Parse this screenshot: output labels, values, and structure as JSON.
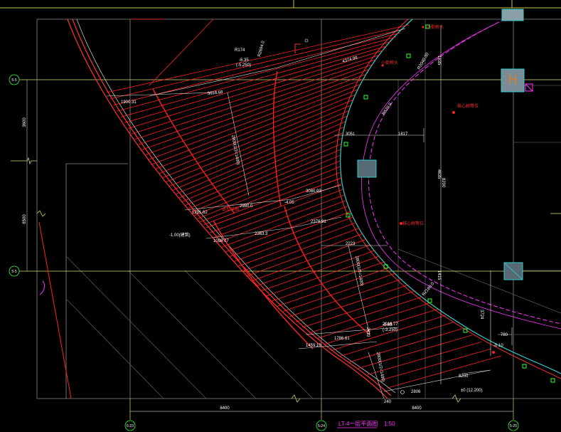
{
  "colors": {
    "background": "#000000",
    "dimension": "#ffffff",
    "stair_red": "#ff2020",
    "magenta": "#ff33ff",
    "cyan": "#33cccc",
    "green": "#00ff00",
    "yellow": "#ffff00",
    "grey": "#808080"
  },
  "axes": {
    "left_top": "5-5",
    "left_mid": "5-5",
    "bottom_left": "5-23",
    "bottom_mid": "5-24",
    "bottom_right": "5-25"
  },
  "radii": {
    "r1": "R2694.0",
    "r2": "R2040.00",
    "r3": "R670.0",
    "r4": "R2160.0"
  },
  "dimensions": {
    "d_1900": "1900.31",
    "d_5618": "5618.68",
    "d_4374": "4374.98",
    "d_2800_23": "2800(1/2=1400)",
    "d_1291": "1291.62",
    "d_2980_a": "2980.0",
    "d_3080": "3080.93",
    "d_1098": "1098.77",
    "d_2363": "2363.3",
    "d_2378": "2378.91",
    "d_3051": "3051",
    "d_1817": "1817",
    "d_8200_mid": "8200",
    "d_2223": "2223",
    "d_2800_30": "2800(1/2=1400)",
    "d_1786": "1786.61",
    "d_2016": "2016.77",
    "d_1459": "1459.10",
    "d_2800_r": "2800(1/2=1400)",
    "d_2806": "2806",
    "d_8200_r": "8200",
    "d_780": "780",
    "d_3724": "3724",
    "d_2410": "2410",
    "d_1635": "1635",
    "d_4635": "4635",
    "d_1415": "1415",
    "d_left_top": "3600",
    "d_left_mid": "8500",
    "d_bottom_left": "8400",
    "d_bottom_right": "8400",
    "d_240": "240"
  },
  "levels": {
    "lv_top": "-6.35",
    "lv_top2": "(-5.250)",
    "lv_mid": "-4.05",
    "lv_left": "-1.00(建筑)",
    "lv_bottom": "-0.05",
    "lv_bottom2": "(-3.250)",
    "lv_r": "-0.10",
    "lv_elev": "±0 (12.200)"
  },
  "notes": {
    "n_top": "R174",
    "n_mid": "请见详图",
    "n_right1": "小街桥头",
    "n_right2": "小街桥头",
    "n_right3": "核心树等位",
    "n_right4": "核心树等位"
  },
  "title": {
    "name": "LT-4一层平面图",
    "scale": "1:50"
  }
}
